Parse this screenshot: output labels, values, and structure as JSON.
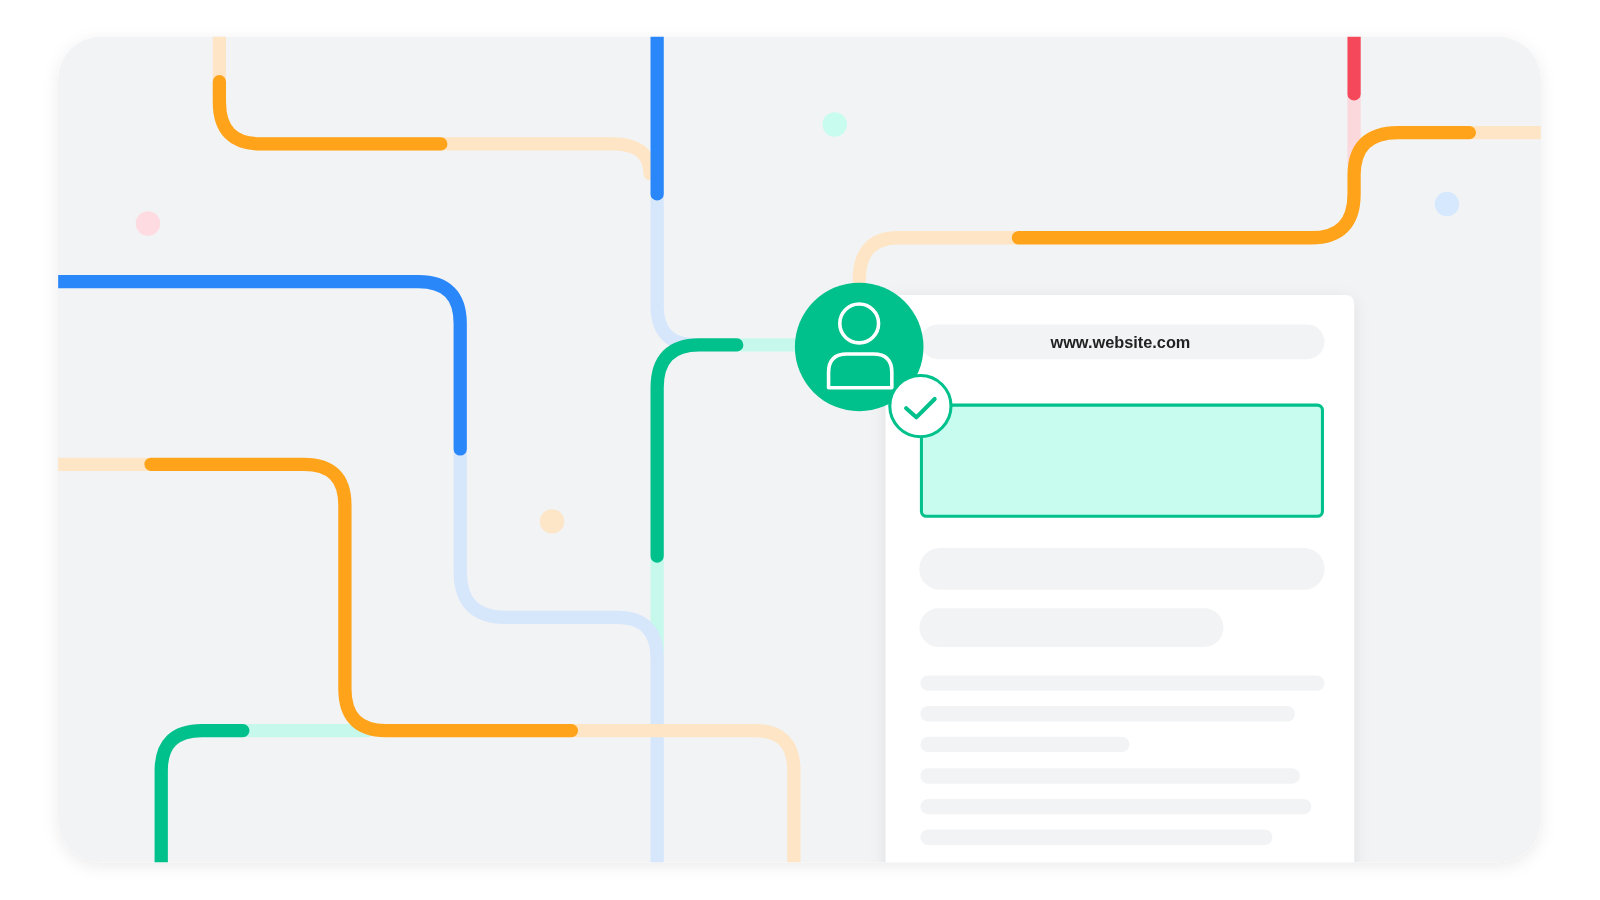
{
  "browser_card": {
    "url": "www.website.com"
  }
}
